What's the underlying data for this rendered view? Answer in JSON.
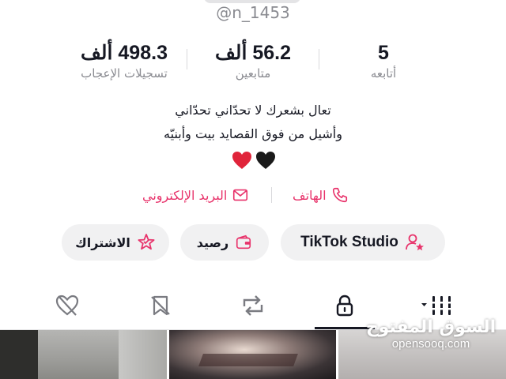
{
  "profile": {
    "username": "@n_1453",
    "bio_line1": "تعال بشعرك لا تحدّاني تحدّاني",
    "bio_line2": "وأشيل من فوق القصايد بيت وأبنيّه"
  },
  "stats": {
    "likes": {
      "value": "498.3 ألف",
      "label": "تسجيلات الإعجاب"
    },
    "followers": {
      "value": "56.2 ألف",
      "label": "متابعين"
    },
    "following": {
      "value": "5",
      "label": "أتابعه"
    }
  },
  "contacts": {
    "phone_label": "الهاتف",
    "email_label": "البريد الإلكتروني"
  },
  "buttons": {
    "studio_label": "TikTok Studio",
    "balance_label": "رصيد",
    "subscription_label": "الاشتراك"
  },
  "tabs": [
    "videos-grid",
    "private",
    "reposts",
    "favorites",
    "liked"
  ],
  "watermark": {
    "arabic": "السوق المفتوح",
    "latin": "opensooq.com"
  },
  "colors": {
    "accent": "#e8336b",
    "text": "#161823",
    "muted": "#8a8b91",
    "button_bg": "#f1f1f2"
  }
}
